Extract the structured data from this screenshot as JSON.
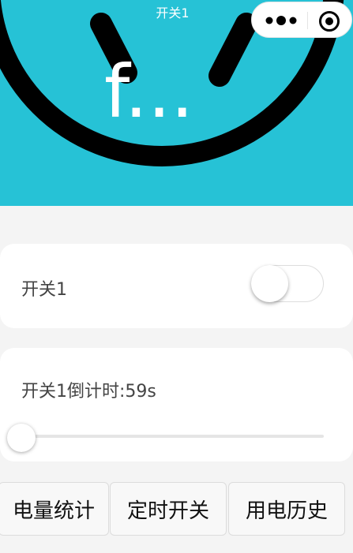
{
  "header": {
    "title": "开关1",
    "icon_text": "f...",
    "background_color": "#26c2d6"
  },
  "capsule": {
    "more_icon": "more-dots-icon",
    "close_icon": "target-circle-icon"
  },
  "switch_card": {
    "label": "开关1",
    "switch_on": false
  },
  "countdown_card": {
    "label": "开关1倒计时:59s",
    "slider_value_fraction": 0.0
  },
  "buttons": {
    "power_stats": "电量统计",
    "timer_switch": "定时开关",
    "power_history": "用电历史"
  }
}
